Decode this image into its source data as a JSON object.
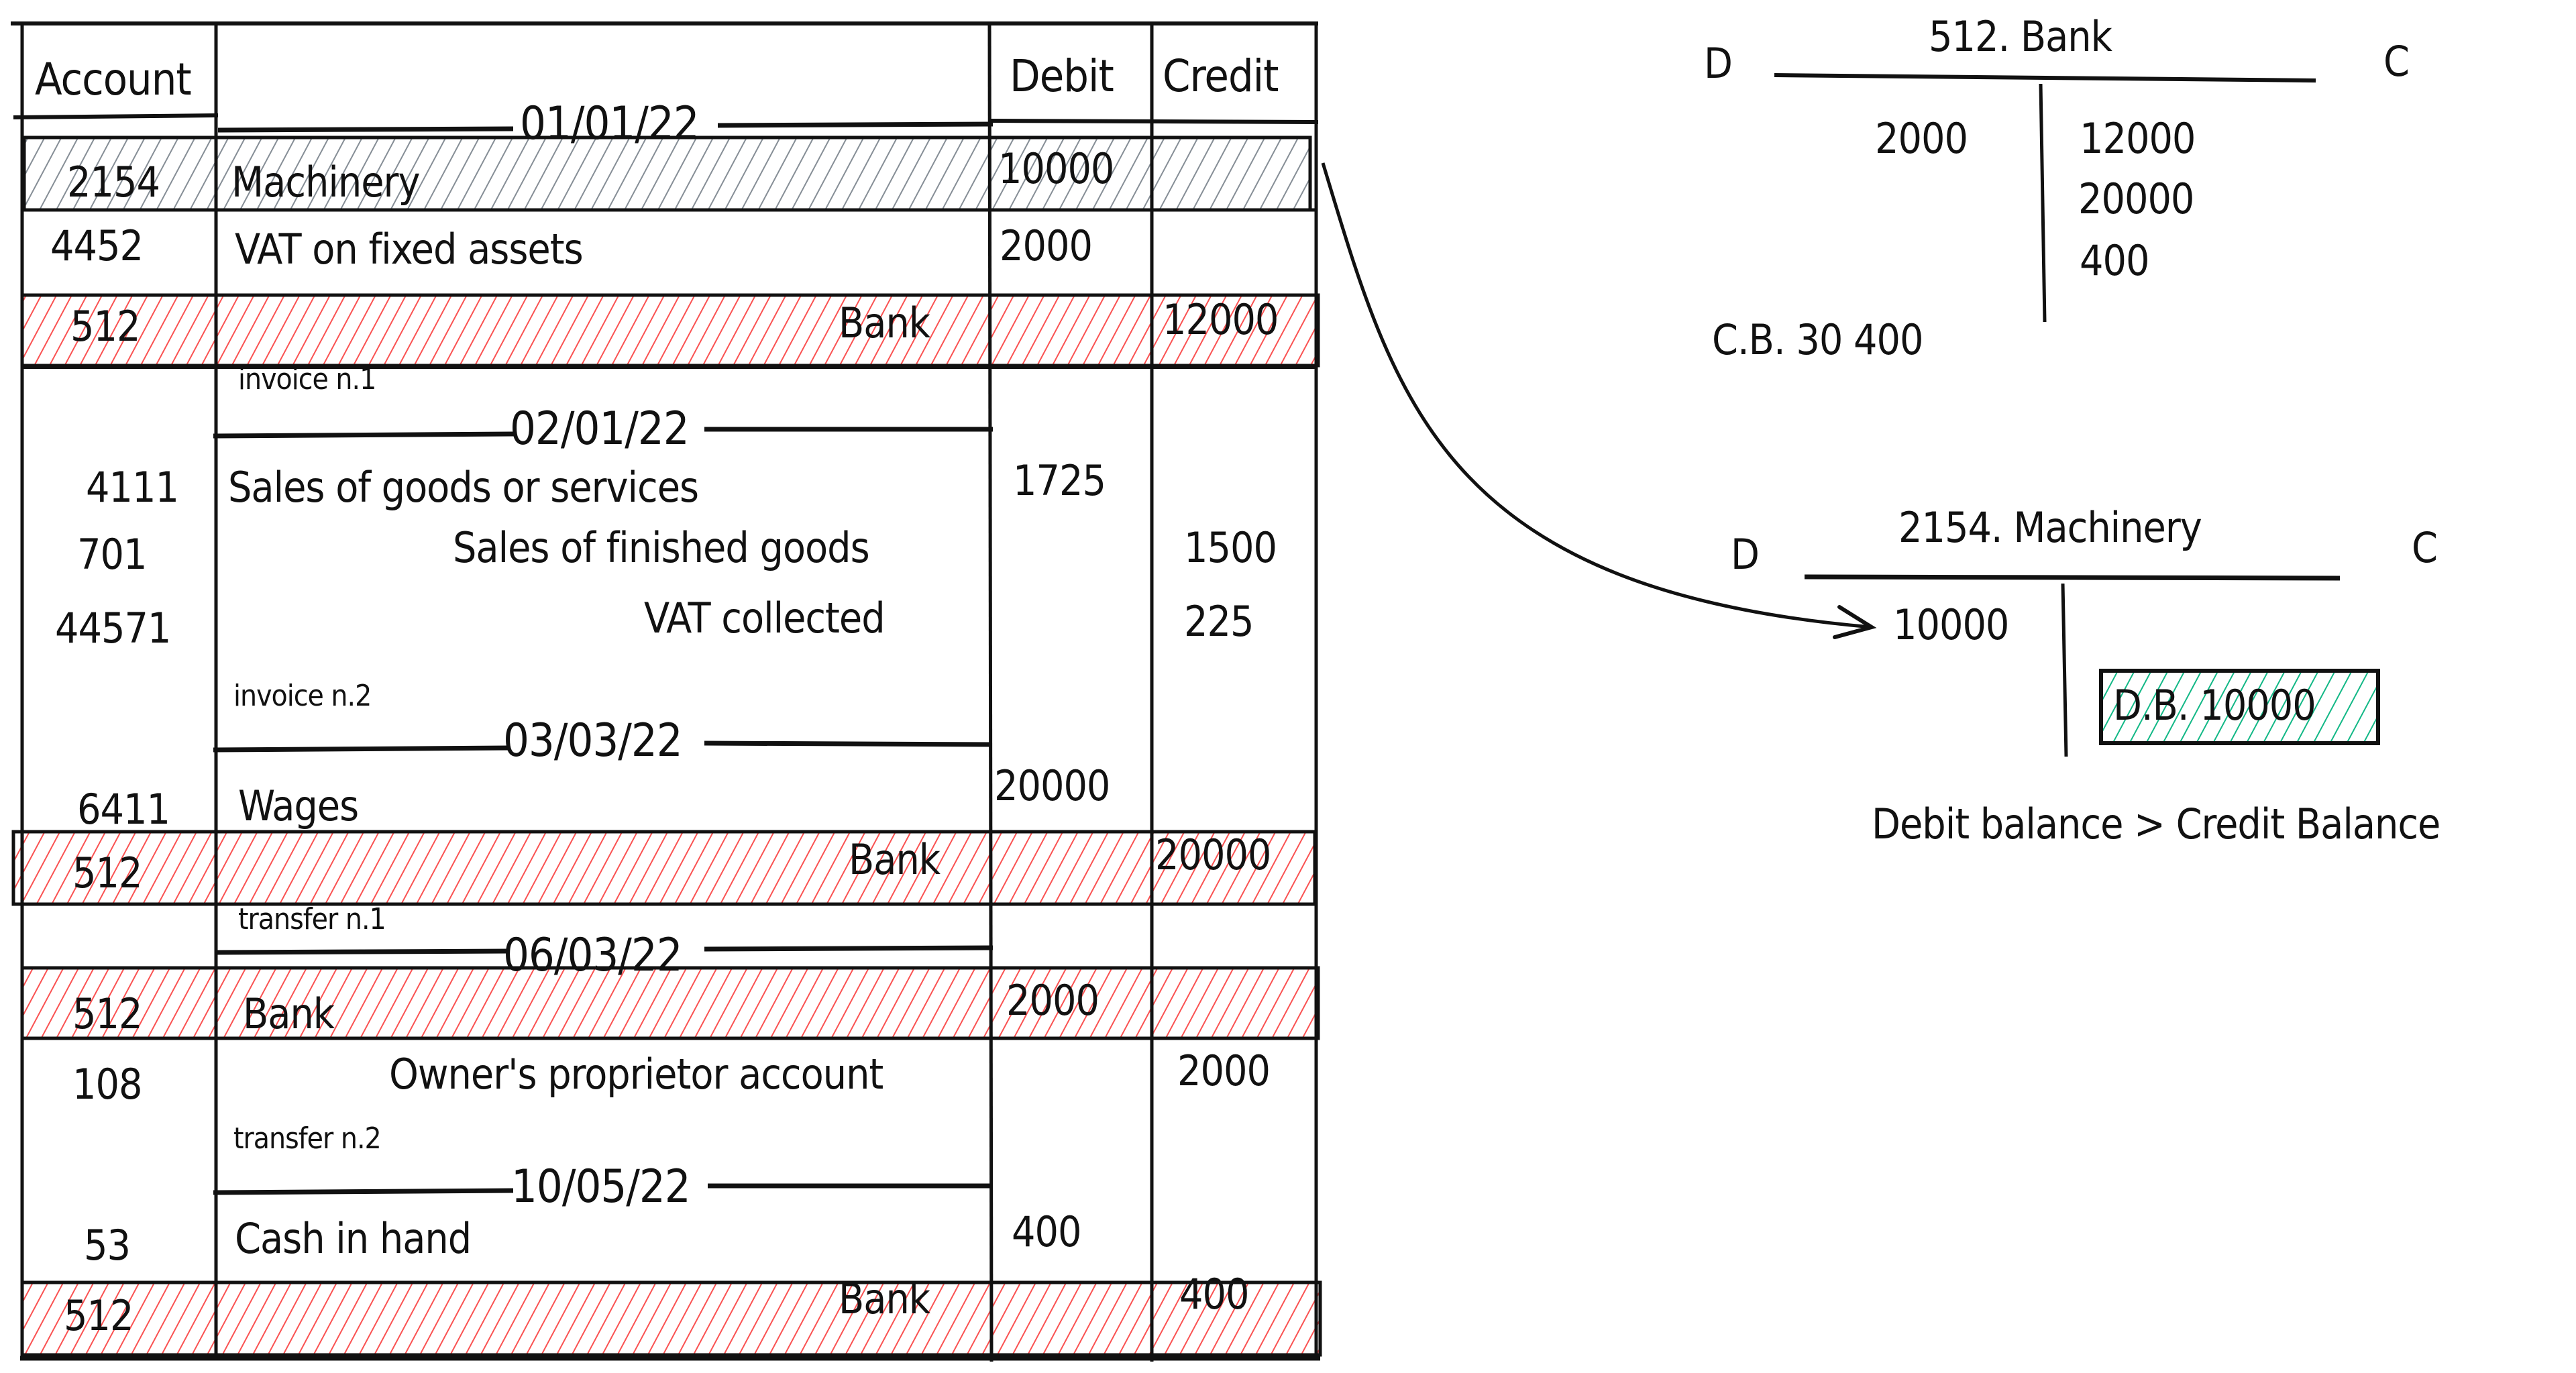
{
  "colors": {
    "ink": "#111111",
    "hatch_grey": "#868e96",
    "hatch_red": "#fa5252",
    "hatch_green": "#12b886"
  },
  "journal": {
    "headers": {
      "account": "Account",
      "description": "",
      "debit": "Debit",
      "credit": "Credit"
    },
    "entries": [
      {
        "date": "01/01/22",
        "note": "invoice n.1",
        "lines": [
          {
            "account": "2154",
            "label": "Machinery",
            "debit": "10000",
            "credit": "",
            "highlight": "grey"
          },
          {
            "account": "4452",
            "label": "VAT on fixed assets",
            "debit": "2000",
            "credit": "",
            "highlight": ""
          },
          {
            "account": "512",
            "label": "Bank",
            "debit": "",
            "credit": "12000",
            "highlight": "red"
          }
        ]
      },
      {
        "date": "02/01/22",
        "note": "invoice n.2",
        "lines": [
          {
            "account": "4111",
            "label": "Sales of goods or services",
            "debit": "1725",
            "credit": "",
            "highlight": ""
          },
          {
            "account": "701",
            "label": "Sales of finished goods",
            "debit": "",
            "credit": "1500",
            "highlight": ""
          },
          {
            "account": "44571",
            "label": "VAT collected",
            "debit": "",
            "credit": "225",
            "highlight": ""
          }
        ]
      },
      {
        "date": "03/03/22",
        "note": "transfer n.1",
        "lines": [
          {
            "account": "6411",
            "label": "Wages",
            "debit": "20000",
            "credit": "",
            "highlight": ""
          },
          {
            "account": "512",
            "label": "Bank",
            "debit": "",
            "credit": "20000",
            "highlight": "red"
          }
        ]
      },
      {
        "date": "06/03/22",
        "note": "transfer n.2",
        "lines": [
          {
            "account": "512",
            "label": "Bank",
            "debit": "2000",
            "credit": "",
            "highlight": "red"
          },
          {
            "account": "108",
            "label": "Owner's proprietor account",
            "debit": "",
            "credit": "2000",
            "highlight": ""
          }
        ]
      },
      {
        "date": "10/05/22",
        "note": "",
        "lines": [
          {
            "account": "53",
            "label": "Cash in hand",
            "debit": "400",
            "credit": "",
            "highlight": ""
          },
          {
            "account": "512",
            "label": "Bank",
            "debit": "",
            "credit": "400",
            "highlight": "red"
          }
        ]
      }
    ]
  },
  "t_accounts": [
    {
      "title": "512. Bank",
      "debit_label": "D",
      "credit_label": "C",
      "debits": [
        "2000"
      ],
      "credits": [
        "12000",
        "20000",
        "400"
      ],
      "balance": "C.B. 30 400"
    },
    {
      "title": "2154. Machinery",
      "debit_label": "D",
      "credit_label": "C",
      "debits": [
        "10000"
      ],
      "credits": [],
      "balance": "D.B. 10000",
      "note": "Debit balance > Credit Balance"
    }
  ]
}
